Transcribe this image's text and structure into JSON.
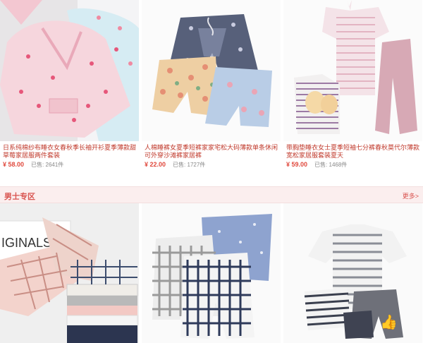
{
  "products": [
    {
      "title": "日系纯棉纱布睡衣女春秋季长袖开衫夏季薄款甜草莓家居服两件套装",
      "price": "¥ 58.00",
      "sold_label": "已售:",
      "sold": "2641件"
    },
    {
      "title": "人棉睡裤女夏季短裤家家宅松大码薄款单条休闲可外穿沙滩裤家居裤",
      "price": "¥ 22.00",
      "sold_label": "已售:",
      "sold": "1727件"
    },
    {
      "title": "带胸垫睡衣女士夏季短袖七分裤春秋莫代尔薄款宽松家居服套装夏天",
      "price": "¥ 59.00",
      "sold_label": "已售:",
      "sold": "1468件"
    }
  ],
  "section": {
    "title": "男士专区",
    "more": "更多>"
  },
  "men_section": {
    "cards": [
      "plaid-pajama",
      "shorts-set",
      "striped-tee-set"
    ]
  },
  "images": {
    "box_text": "IGINALS"
  }
}
